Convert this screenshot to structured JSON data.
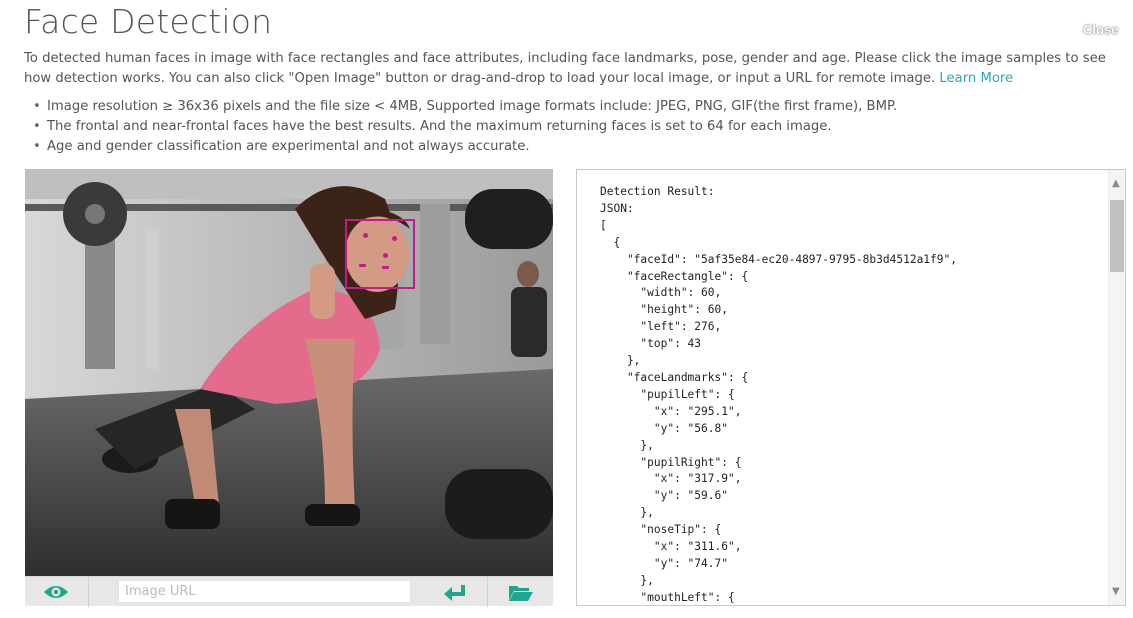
{
  "page": {
    "title": "Face Detection",
    "close_label": "Close"
  },
  "description": {
    "text": "To detected human faces in image with face rectangles and face attributes, including face landmarks, pose, gender and age. Please click the image samples to see how detection works. You can also click \"Open Image\" button or drag-and-drop to load your local image, or input a URL for remote image.",
    "link_label": "Learn More"
  },
  "bullets": [
    "Image resolution ≥ 36x36 pixels and the file size < 4MB, Supported image formats include: JPEG, PNG, GIF(the first frame), BMP.",
    "The frontal and near-frontal faces have the best results. And the maximum returning faces is set to 64 for each image.",
    "Age and gender classification are experimental and not always accurate."
  ],
  "toolbar": {
    "url_placeholder": "Image URL",
    "icons": [
      "eye-icon",
      "enter-arrow-icon",
      "folder-icon"
    ]
  },
  "colors": {
    "accent": "#27a9b9",
    "face_box": "#c31a8c",
    "toolbar_icon": "#1fa68e"
  },
  "result": {
    "text": "Detection Result:\nJSON:\n[\n  {\n    \"faceId\": \"5af35e84-ec20-4897-9795-8b3d4512a1f9\",\n    \"faceRectangle\": {\n      \"width\": 60,\n      \"height\": 60,\n      \"left\": 276,\n      \"top\": 43\n    },\n    \"faceLandmarks\": {\n      \"pupilLeft\": {\n        \"x\": \"295.1\",\n        \"y\": \"56.8\"\n      },\n      \"pupilRight\": {\n        \"x\": \"317.9\",\n        \"y\": \"59.6\"\n      },\n      \"noseTip\": {\n        \"x\": \"311.6\",\n        \"y\": \"74.7\"\n      },\n      \"mouthLeft\": {"
  }
}
